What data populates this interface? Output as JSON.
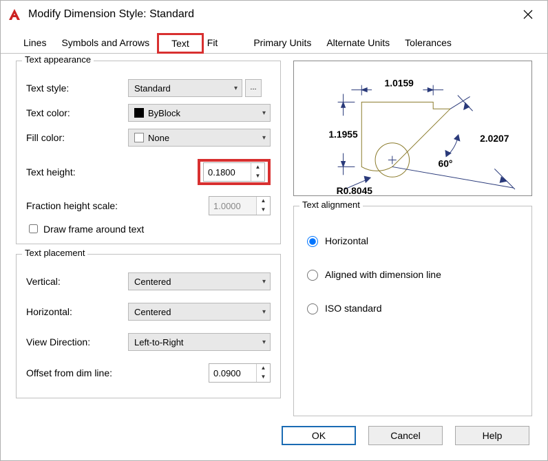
{
  "window": {
    "title": "Modify Dimension Style: Standard"
  },
  "tabs": [
    {
      "label": "Lines"
    },
    {
      "label": "Symbols and Arrows"
    },
    {
      "label": "Text"
    },
    {
      "label": "Fit"
    },
    {
      "label": "Primary Units"
    },
    {
      "label": "Alternate Units"
    },
    {
      "label": "Tolerances"
    }
  ],
  "active_tab": "Text",
  "text_appearance": {
    "legend": "Text appearance",
    "style": {
      "label": "Text style:",
      "value": "Standard"
    },
    "color": {
      "label": "Text color:",
      "value": "ByBlock"
    },
    "fill": {
      "label": "Fill color:",
      "value": "None"
    },
    "height": {
      "label": "Text height:",
      "value": "0.1800"
    },
    "fraction_scale": {
      "label": "Fraction height scale:",
      "value": "1.0000"
    },
    "draw_frame": {
      "label": "Draw frame around text",
      "checked": false
    }
  },
  "text_placement": {
    "legend": "Text placement",
    "vertical": {
      "label": "Vertical:",
      "value": "Centered"
    },
    "horizontal": {
      "label": "Horizontal:",
      "value": "Centered"
    },
    "view_direction": {
      "label": "View Direction:",
      "value": "Left-to-Right"
    },
    "offset": {
      "label": "Offset from dim line:",
      "value": "0.0900"
    }
  },
  "text_alignment": {
    "legend": "Text alignment",
    "options": [
      {
        "label": "Horizontal",
        "selected": true
      },
      {
        "label": "Aligned with dimension line",
        "selected": false
      },
      {
        "label": "ISO standard",
        "selected": false
      }
    ]
  },
  "preview_dims": {
    "top": "1.0159",
    "left": "1.1955",
    "diag": "2.0207",
    "angle": "60°",
    "radius": "R0.8045"
  },
  "footer": {
    "ok": "OK",
    "cancel": "Cancel",
    "help": "Help"
  }
}
